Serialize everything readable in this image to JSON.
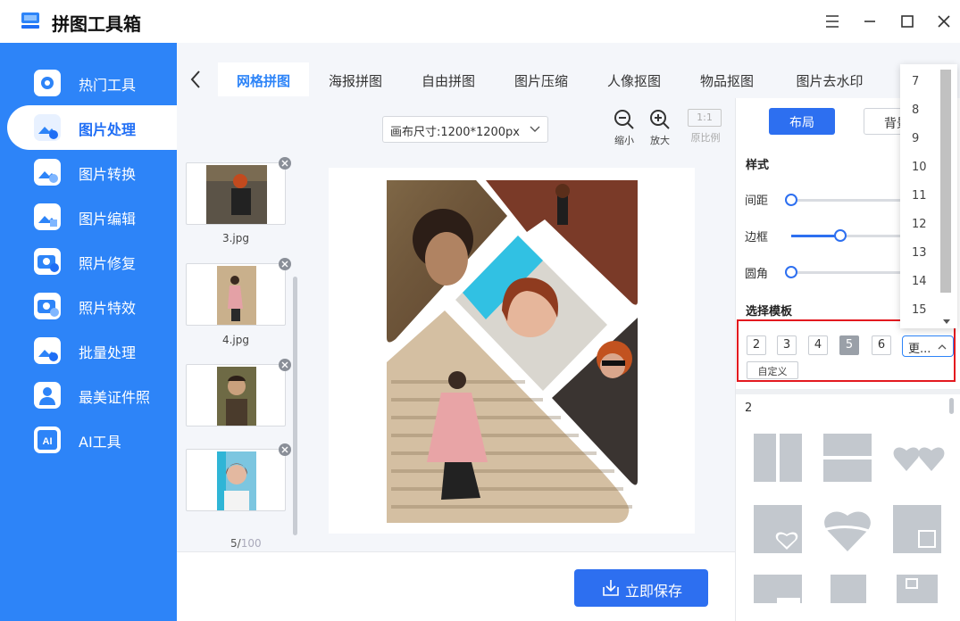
{
  "app": {
    "title": "拼图工具箱"
  },
  "sidebar": {
    "items": [
      {
        "label": "热门工具"
      },
      {
        "label": "图片处理"
      },
      {
        "label": "图片转换"
      },
      {
        "label": "图片编辑"
      },
      {
        "label": "照片修复"
      },
      {
        "label": "照片特效"
      },
      {
        "label": "批量处理"
      },
      {
        "label": "最美证件照"
      },
      {
        "label": "AI工具"
      }
    ]
  },
  "tabs": [
    {
      "label": "网格拼图"
    },
    {
      "label": "海报拼图"
    },
    {
      "label": "自由拼图"
    },
    {
      "label": "图片压缩"
    },
    {
      "label": "人像抠图"
    },
    {
      "label": "物品抠图"
    },
    {
      "label": "图片去水印"
    }
  ],
  "toolbar": {
    "canvas_size": "画布尺寸:1200*1200px",
    "zoom_out": "缩小",
    "zoom_in": "放大",
    "ratio_icon": "1:1",
    "original_ratio": "原比例"
  },
  "thumbnails": [
    {
      "name": "3.jpg"
    },
    {
      "name": "4.jpg"
    },
    {
      "name": ""
    },
    {
      "name": ""
    }
  ],
  "image_count": {
    "current": "5/",
    "max": "100"
  },
  "save_button": "立即保存",
  "right_panel": {
    "layout_btn": "布局",
    "background_btn": "背景",
    "style_title": "样式",
    "sliders": [
      {
        "label": "间距",
        "value": 0
      },
      {
        "label": "边框",
        "value": 0.42
      },
      {
        "label": "圆角",
        "value": 0
      }
    ],
    "template_title": "选择模板",
    "template_counts": [
      "2",
      "3",
      "4",
      "5",
      "6"
    ],
    "selected_count": "5",
    "more_btn": "更...",
    "custom_btn": "自定义",
    "layout_count_label": "2"
  },
  "dropdown": {
    "options": [
      "7",
      "8",
      "9",
      "10",
      "11",
      "12",
      "13",
      "14",
      "15"
    ]
  },
  "colors": {
    "accent": "#2d84f8",
    "primary_button": "#2d6ff0",
    "highlight": "#e3191f"
  }
}
